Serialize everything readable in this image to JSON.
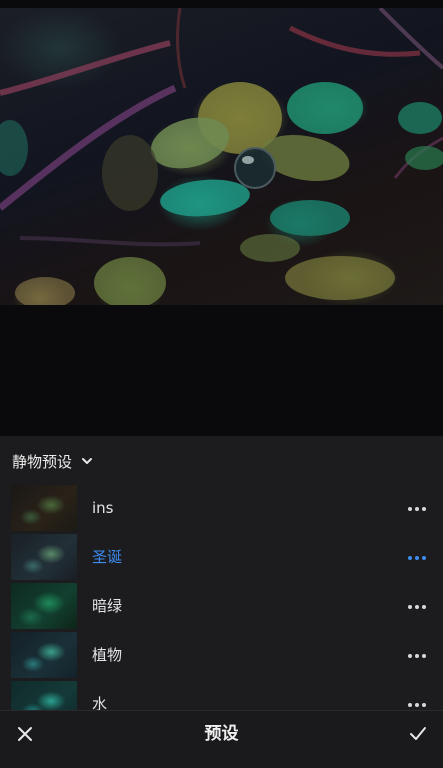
{
  "preview": {
    "image_desc": "leaf-macro-photo"
  },
  "panel": {
    "category_label": "静物预设",
    "presets": [
      {
        "label": "ins",
        "active": false,
        "thumb": "dark-leaves"
      },
      {
        "label": "圣诞",
        "active": true,
        "thumb": "teal-leaves"
      },
      {
        "label": "暗绿",
        "active": false,
        "thumb": "green-leaves"
      },
      {
        "label": "植物",
        "active": false,
        "thumb": "cyan-leaves"
      },
      {
        "label": "水",
        "active": false,
        "thumb": "aqua-leaves"
      }
    ]
  },
  "toolbar": {
    "title": "预设",
    "close_icon": "close-icon",
    "confirm_icon": "check-icon"
  },
  "colors": {
    "accent": "#3d8cf0",
    "panel_bg": "#1c1c1f",
    "text": "#e4e4e4"
  }
}
